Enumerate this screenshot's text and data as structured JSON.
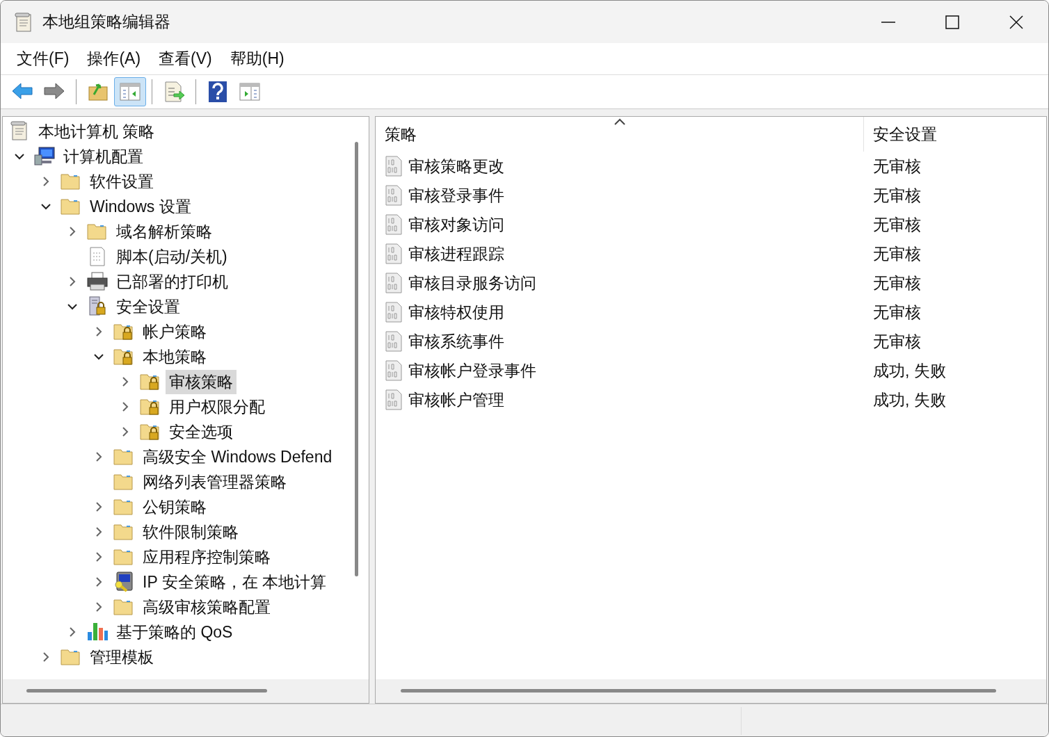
{
  "window": {
    "title": "本地组策略编辑器"
  },
  "menu": [
    {
      "label": "文件(F)"
    },
    {
      "label": "操作(A)"
    },
    {
      "label": "查看(V)"
    },
    {
      "label": "帮助(H)"
    }
  ],
  "toolbar": [
    [
      {
        "kind": "back",
        "pressed": false
      },
      {
        "kind": "forward",
        "pressed": false
      }
    ],
    [
      {
        "kind": "up",
        "pressed": false
      },
      {
        "kind": "tree-toggle",
        "pressed": true
      }
    ],
    [
      {
        "kind": "export",
        "pressed": false
      }
    ],
    [
      {
        "kind": "help",
        "pressed": false
      },
      {
        "kind": "action-toggle",
        "pressed": false
      }
    ]
  ],
  "tree": [
    {
      "label": "本地计算机 策略",
      "kind": "policy",
      "selected": false,
      "children": [
        {
          "label": "计算机配置",
          "kind": "computer",
          "expanded": true,
          "selected": false,
          "children": [
            {
              "label": "软件设置",
              "kind": "folder",
              "expanded": false,
              "selected": false
            },
            {
              "label": "Windows 设置",
              "kind": "folder",
              "expanded": true,
              "selected": false,
              "children": [
                {
                  "label": "域名解析策略",
                  "kind": "folder",
                  "expanded": false,
                  "selected": false
                },
                {
                  "label": "脚本(启动/关机)",
                  "kind": "script",
                  "selected": false
                },
                {
                  "label": "已部署的打印机",
                  "kind": "printer",
                  "expanded": false,
                  "selected": false
                },
                {
                  "label": "安全设置",
                  "kind": "security",
                  "expanded": true,
                  "selected": false,
                  "children": [
                    {
                      "label": "帐户策略",
                      "kind": "lock-folder",
                      "expanded": false,
                      "selected": false
                    },
                    {
                      "label": "本地策略",
                      "kind": "lock-folder",
                      "expanded": true,
                      "selected": false,
                      "children": [
                        {
                          "label": "审核策略",
                          "kind": "lock-folder",
                          "expanded": false,
                          "selected": true
                        },
                        {
                          "label": "用户权限分配",
                          "kind": "lock-folder",
                          "expanded": false,
                          "selected": false
                        },
                        {
                          "label": "安全选项",
                          "kind": "lock-folder",
                          "expanded": false,
                          "selected": false
                        }
                      ]
                    },
                    {
                      "label": "高级安全 Windows Defend",
                      "kind": "folder",
                      "expanded": false,
                      "selected": false
                    },
                    {
                      "label": "网络列表管理器策略",
                      "kind": "folder",
                      "selected": false
                    },
                    {
                      "label": "公钥策略",
                      "kind": "folder",
                      "expanded": false,
                      "selected": false
                    },
                    {
                      "label": "软件限制策略",
                      "kind": "folder",
                      "expanded": false,
                      "selected": false
                    },
                    {
                      "label": "应用程序控制策略",
                      "kind": "folder",
                      "expanded": false,
                      "selected": false
                    },
                    {
                      "label": "IP 安全策略，在 本地计算",
                      "kind": "ip-security",
                      "expanded": false,
                      "selected": false
                    },
                    {
                      "label": "高级审核策略配置",
                      "kind": "folder",
                      "expanded": false,
                      "selected": false
                    }
                  ]
                },
                {
                  "label": "基于策略的 QoS",
                  "kind": "qos",
                  "expanded": false,
                  "selected": false
                }
              ]
            },
            {
              "label": "管理模板",
              "kind": "folder",
              "expanded": false,
              "selected": false
            }
          ]
        }
      ]
    }
  ],
  "table": {
    "columns": [
      {
        "label": "策略",
        "sorted": true
      },
      {
        "label": "安全设置",
        "sorted": false
      }
    ],
    "rows": [
      {
        "policy": "审核策略更改",
        "setting": "无审核"
      },
      {
        "policy": "审核登录事件",
        "setting": "无审核"
      },
      {
        "policy": "审核对象访问",
        "setting": "无审核"
      },
      {
        "policy": "审核进程跟踪",
        "setting": "无审核"
      },
      {
        "policy": "审核目录服务访问",
        "setting": "无审核"
      },
      {
        "policy": "审核特权使用",
        "setting": "无审核"
      },
      {
        "policy": "审核系统事件",
        "setting": "无审核"
      },
      {
        "policy": "审核帐户登录事件",
        "setting": "成功, 失败"
      },
      {
        "policy": "审核帐户管理",
        "setting": "成功, 失败"
      }
    ]
  }
}
